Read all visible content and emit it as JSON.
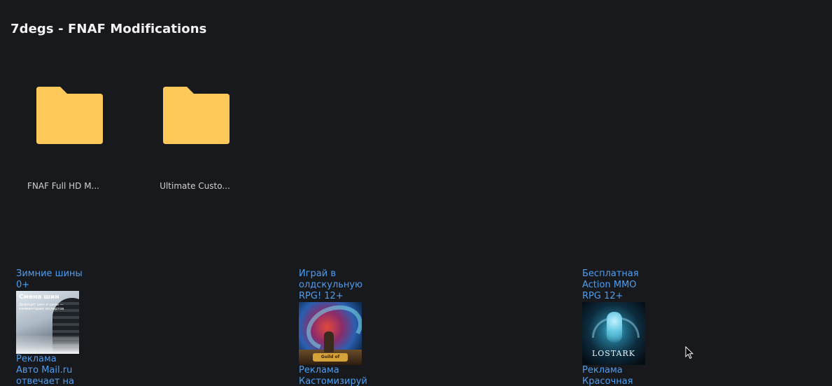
{
  "page": {
    "title": "7degs - FNAF Modifications"
  },
  "folders": [
    {
      "label": "FNAF Full HD M...",
      "icon": "folder-icon",
      "color": "#ffc85a"
    },
    {
      "label": "Ultimate Custo...",
      "icon": "folder-icon",
      "color": "#ffc85a"
    }
  ],
  "ads": [
    {
      "title_lines": [
        "Зимние шины",
        "0+"
      ],
      "image_caption": "Смена шин",
      "image_subtext": "Дефицит шин и цены — комментарии экспертов",
      "footer_lines": [
        "Реклама",
        "Авто Mail.ru",
        "отвечает на"
      ]
    },
    {
      "title_lines": [
        "Играй в",
        "олдскульную",
        "RPG! 12+"
      ],
      "image_caption": "Guild of Heroes",
      "footer_lines": [
        "Реклама",
        "Кастомизируй"
      ]
    },
    {
      "title_lines": [
        "Бесплатная",
        "Action MMO",
        "RPG 12+"
      ],
      "image_caption": "LOSTARK",
      "footer_lines": [
        "Реклама",
        "Красочная"
      ]
    }
  ],
  "colors": {
    "background": "#18191d",
    "folder": "#ffc85a",
    "link": "#4e9ef0"
  }
}
